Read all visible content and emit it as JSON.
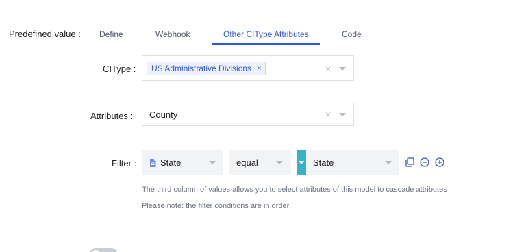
{
  "form": {
    "predefined_label": "Predefined value :",
    "tabs": [
      {
        "label": "Define"
      },
      {
        "label": "Webhook"
      },
      {
        "label": "Other CIType Attributes"
      },
      {
        "label": "Code"
      }
    ],
    "active_tab": "Other CIType Attributes",
    "citype": {
      "label": "CIType :",
      "tag": "US Administrative Divisions",
      "tag_remove": "×",
      "clear": "×"
    },
    "attributes": {
      "label": "Attributes :",
      "value": "County",
      "clear": "×"
    },
    "filter": {
      "label": "Filter :",
      "attribute": "State",
      "operator": "equal",
      "value": "State"
    },
    "hints": [
      "The third column of values allows you to select attributes of this model to cascade attributes",
      "Please note: the filter conditions are in order"
    ]
  },
  "colors": {
    "accent": "#2f54eb",
    "filter_toggle": "#36b3c9",
    "border": "#dcdfe6",
    "muted_text": "#6b7280"
  },
  "icons": [
    "doc-icon",
    "caret-down-icon",
    "copy-icon",
    "minus-circle-icon",
    "plus-circle-icon",
    "close-icon"
  ]
}
